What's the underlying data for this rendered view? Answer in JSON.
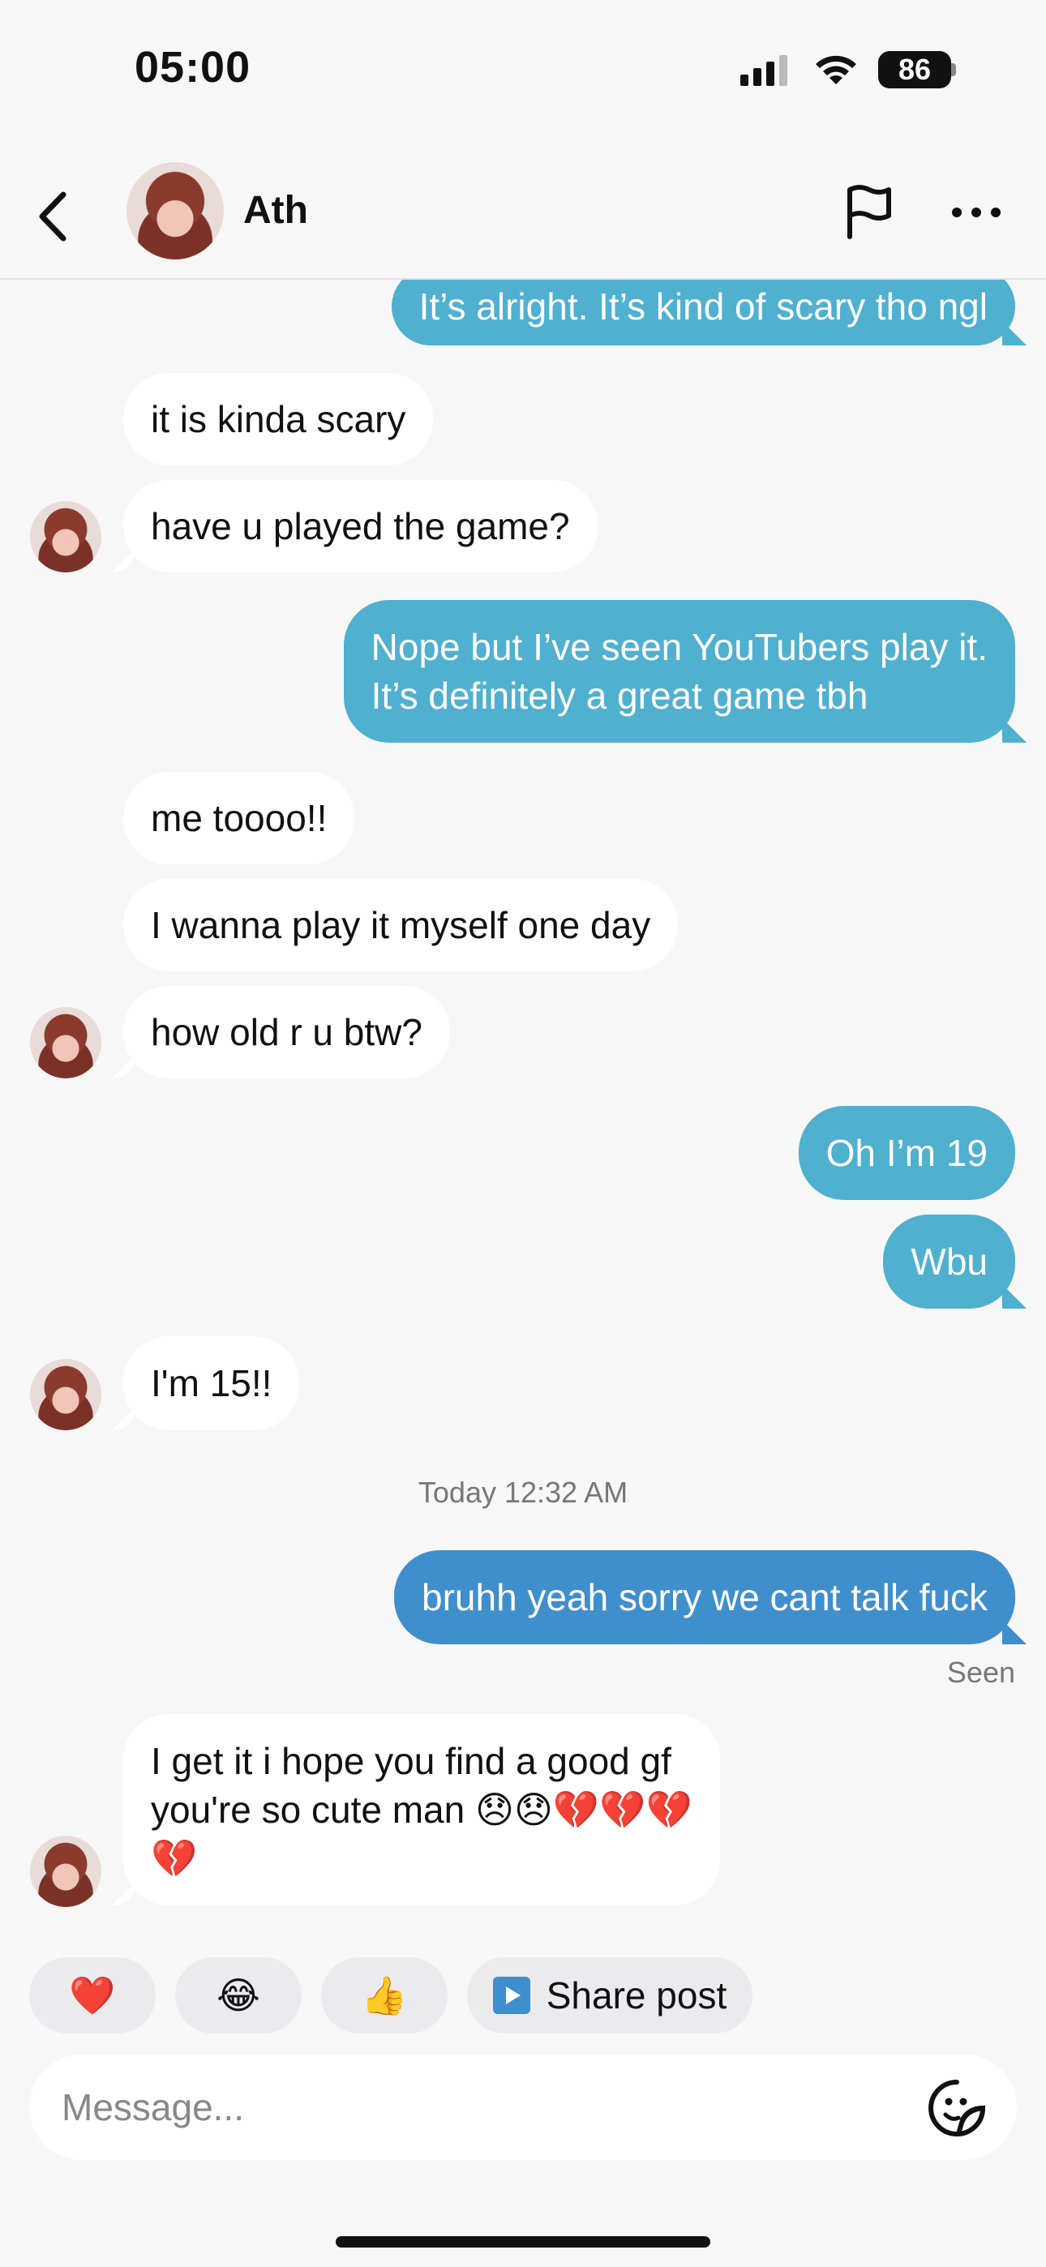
{
  "status_bar": {
    "time": "05:00",
    "battery": "86"
  },
  "header": {
    "contact_name": "Ath"
  },
  "messages": [
    {
      "text": "It’s alright. It’s kind of scary tho ngl",
      "from": "me"
    },
    {
      "text": "it is kinda scary",
      "from": "them"
    },
    {
      "text": "have u played the game?",
      "from": "them"
    },
    {
      "text_line1": "Nope but I’ve seen YouTubers play it.",
      "text_line2": "It’s definitely a great game tbh",
      "from": "me"
    },
    {
      "text": "me toooo!!",
      "from": "them"
    },
    {
      "text": "I wanna play it myself one day",
      "from": "them"
    },
    {
      "text": "how old r u btw?",
      "from": "them"
    },
    {
      "text": "Oh I’m 19",
      "from": "me"
    },
    {
      "text": "Wbu",
      "from": "me"
    },
    {
      "text": "I'm 15!!",
      "from": "them"
    },
    {
      "text": "bruhh yeah sorry we cant talk fuck",
      "from": "me"
    },
    {
      "text_line1": "I get it i hope you find a good gf",
      "text_line2": "you're so cute man 😞😞💔💔💔",
      "text_line3": "💔",
      "from": "them"
    }
  ],
  "timestamp": "Today 12:32 AM",
  "seen_label": "Seen",
  "quick_reactions": {
    "heart": "❤️",
    "laugh": "😂",
    "thumbs_up": "👍",
    "share_label": "Share post"
  },
  "composer": {
    "placeholder": "Message..."
  },
  "colors": {
    "outgoing_bubble": "#4fb0d0",
    "outgoing_latest": "#3f8fcc",
    "incoming_bubble": "#ffffff",
    "background": "#f7f7f8"
  }
}
